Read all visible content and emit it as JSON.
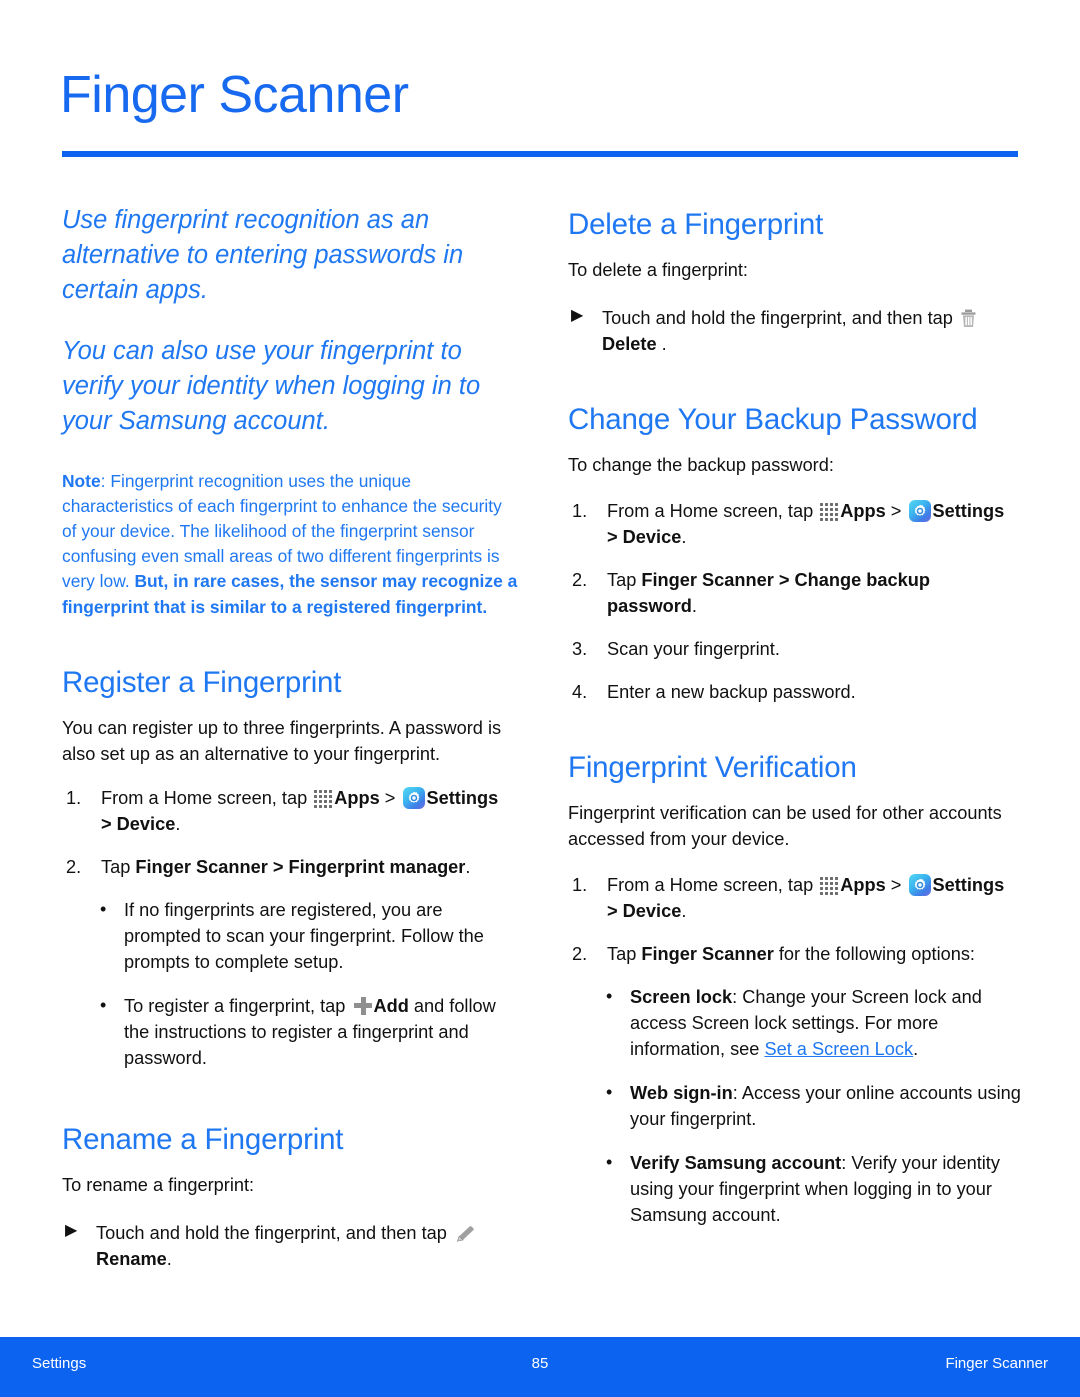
{
  "header": {
    "title": "Finger Scanner"
  },
  "colors": {
    "brand_blue": "#1f78f2",
    "rule_blue": "#0b63ef",
    "footer_blue": "#0b63ef",
    "link_blue": "#1f78f2"
  },
  "left_column": {
    "lead_1": "Use fingerprint recognition as an alternative to entering passwords in certain apps.",
    "lead_2": "You can also use your fingerprint to verify your identity when logging in to your Samsung account.",
    "note": {
      "label": "Note",
      "separator": ": ",
      "text": "Fingerprint recognition uses the unique characteristics of each fingerprint to enhance the security of your device. The likelihood of the fingerprint sensor confusing even small areas of two different fingerprints is very low. ",
      "bold_tail": "But, in rare cases, the sensor may recognize a fingerprint that is similar to a registered fingerprint."
    },
    "register": {
      "heading": "Register a Fingerprint",
      "intro": "You can register up to three fingerprints. A password is also set up as an alternative to your fingerprint.",
      "step1": {
        "num": "1.",
        "pre": "From a Home screen, tap ",
        "apps_label": "Apps",
        "sep": " > ",
        "settings_label": "Settings",
        "tail_bold": "> Device",
        "tail_end": "."
      },
      "step2": {
        "num": "2.",
        "pre": "Tap ",
        "bold": "Finger Scanner > Fingerprint manager",
        "end": "."
      },
      "bullet1": "If no fingerprints are registered, you are prompted to scan your fingerprint. Follow the prompts to complete setup.",
      "bullet2": {
        "pre": "To register a fingerprint, tap ",
        "bold": "Add",
        "post": " and follow the instructions to register a fingerprint and password."
      }
    },
    "rename": {
      "heading": "Rename a Fingerprint",
      "intro": "To rename a fingerprint:",
      "step": {
        "pre": "Touch and hold the fingerprint, and then tap ",
        "bold": "Rename",
        "end": "."
      }
    }
  },
  "right_column": {
    "delete": {
      "heading": "Delete a Fingerprint",
      "intro": "To delete a fingerprint:",
      "step": {
        "pre": "Touch and hold the fingerprint, and then tap ",
        "bold": "Delete",
        "end": " ."
      }
    },
    "change_backup": {
      "heading": "Change Your Backup Password",
      "intro": "To change the backup password:",
      "step1": {
        "num": "1.",
        "pre": "From a Home screen, tap ",
        "apps_label": "Apps",
        "sep": " > ",
        "settings_label": "Settings",
        "tail_bold": "> Device",
        "tail_end": "."
      },
      "step2": {
        "num": "2.",
        "pre": "Tap ",
        "bold": "Finger Scanner > Change backup password",
        "end": "."
      },
      "step3": {
        "num": "3.",
        "text": "Scan your fingerprint."
      },
      "step4": {
        "num": "4.",
        "text": "Enter a new backup password."
      }
    },
    "verification": {
      "heading": "Fingerprint Verification",
      "intro": "Fingerprint verification can be used for other accounts accessed from your device.",
      "step1": {
        "num": "1.",
        "pre": "From a Home screen, tap ",
        "apps_label": "Apps",
        "sep": " > ",
        "settings_label": "Settings",
        "tail_bold": "> Device",
        "tail_end": "."
      },
      "step2": {
        "num": "2.",
        "pre": "Tap ",
        "bold": "Finger Scanner",
        "post": " for the following options:"
      },
      "options": {
        "screen_lock": {
          "term": "Screen lock",
          "text_a": ": Change your Screen lock and access Screen lock settings. For more information, see ",
          "link": "Set a Screen Lock",
          "text_b": "."
        },
        "web_signin": {
          "term": "Web sign-in",
          "text": ": Access your online accounts using your fingerprint."
        },
        "verify_samsung": {
          "term": "Verify Samsung account",
          "text": ": Verify your identity using your fingerprint when logging in to your Samsung account."
        }
      }
    }
  },
  "footer": {
    "left": "Settings",
    "page_number": "85",
    "right": "Finger Scanner"
  },
  "glyphs": {
    "arrow_bullet": "▶",
    "round_bullet": "•"
  }
}
